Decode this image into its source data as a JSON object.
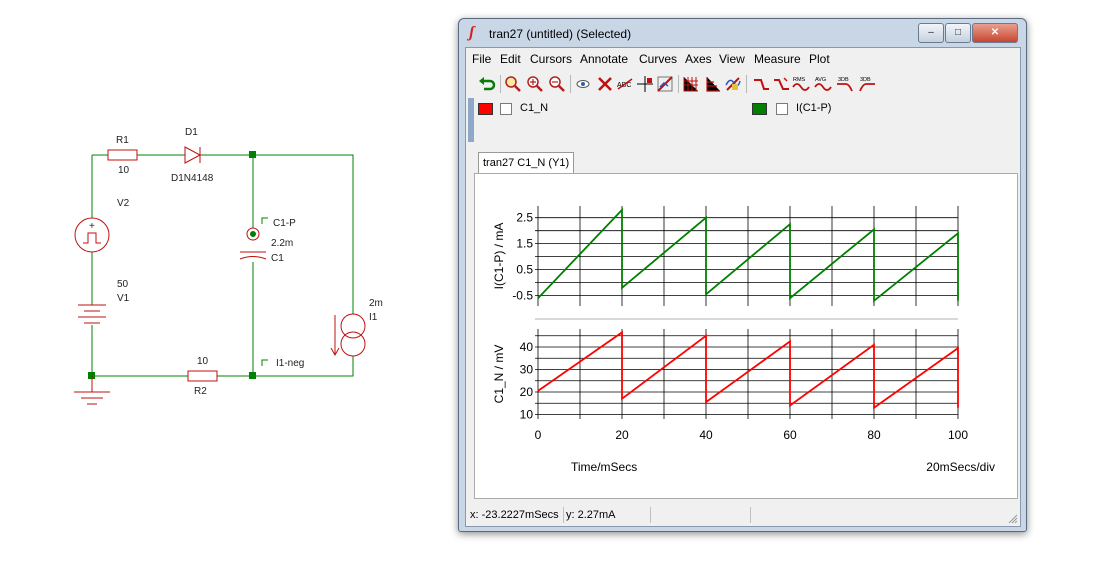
{
  "schematic": {
    "r1_name": "R1",
    "r1_value": "10",
    "d1_name": "D1",
    "d1_model": "D1N4148",
    "v2_name": "V2",
    "v1_value": "50",
    "v1_name": "V1",
    "c1_probe": "C1-P",
    "c1_value": "2.2m",
    "c1_name": "C1",
    "i1_value": "2m",
    "i1_name": "I1",
    "r2_value": "10",
    "r2_name": "R2",
    "neg_probe": "I1-neg"
  },
  "window": {
    "title": "tran27 (untitled) (Selected)",
    "minimize": "–",
    "maximize": "□",
    "close": "✕"
  },
  "menu": [
    "File",
    "Edit",
    "Cursors",
    "Annotate",
    "Curves",
    "Axes",
    "View",
    "Measure",
    "Plot"
  ],
  "toolbar": {
    "icons": [
      "undo-icon",
      "zoom-full-icon",
      "zoom-in-icon",
      "zoom-out-icon",
      "eye-icon",
      "delete-curve-icon",
      "label-icon",
      "cursor-cross-icon",
      "edit-axes-icon",
      "grid-icon",
      "axis-icon",
      "curve-edit-icon",
      "fall-icon",
      "rise-icon",
      "rms-icon",
      "avg-icon",
      "3db-low-icon",
      "3db-high-icon"
    ],
    "rms_label": "RMS",
    "avg_label": "AVG",
    "db_label": "3DB"
  },
  "legend": [
    {
      "label": "C1_N",
      "color": "#ff0000"
    },
    {
      "label": "I(C1-P)",
      "color": "#008000"
    }
  ],
  "tab_label": "tran27 C1_N (Y1)",
  "status": {
    "x": "x: -23.2227mSecs",
    "y": "y: 2.27mA"
  },
  "chart_data": [
    {
      "type": "line",
      "ylabel": "I(C1-P) / mA",
      "xlabel": "Time/mSecs",
      "xlim": [
        0,
        100
      ],
      "ylim": [
        -0.9,
        2.95
      ],
      "yticks": [
        "2.5",
        "1.5",
        "0.5",
        "-0.5"
      ],
      "ytick_values": [
        2.5,
        1.5,
        0.5,
        -0.5
      ],
      "series": [
        {
          "name": "I(C1-P)",
          "color": "#008000",
          "x": [
            0,
            20,
            20,
            40,
            40,
            60,
            60,
            80,
            80,
            100,
            100
          ],
          "y": [
            -0.6,
            2.8,
            -0.2,
            2.5,
            -0.45,
            2.25,
            -0.6,
            2.05,
            -0.7,
            1.9,
            -0.7
          ]
        }
      ]
    },
    {
      "type": "line",
      "ylabel": "C1_N / mV",
      "xlabel": "Time/mSecs",
      "xscale_label": "20mSecs/div",
      "xlim": [
        0,
        100
      ],
      "ylim": [
        8,
        48
      ],
      "xticks": [
        "0",
        "20",
        "40",
        "60",
        "80",
        "100"
      ],
      "xtick_values": [
        0,
        20,
        40,
        60,
        80,
        100
      ],
      "yticks": [
        "40",
        "30",
        "20",
        "10"
      ],
      "ytick_values": [
        40,
        30,
        20,
        10
      ],
      "series": [
        {
          "name": "C1_N",
          "color": "#ff0000",
          "x": [
            0,
            20,
            20,
            40,
            40,
            60,
            60,
            80,
            80,
            100,
            100
          ],
          "y": [
            20.5,
            46.5,
            17,
            45,
            15.5,
            42.5,
            14,
            41,
            13,
            39.5,
            13
          ]
        }
      ]
    }
  ]
}
